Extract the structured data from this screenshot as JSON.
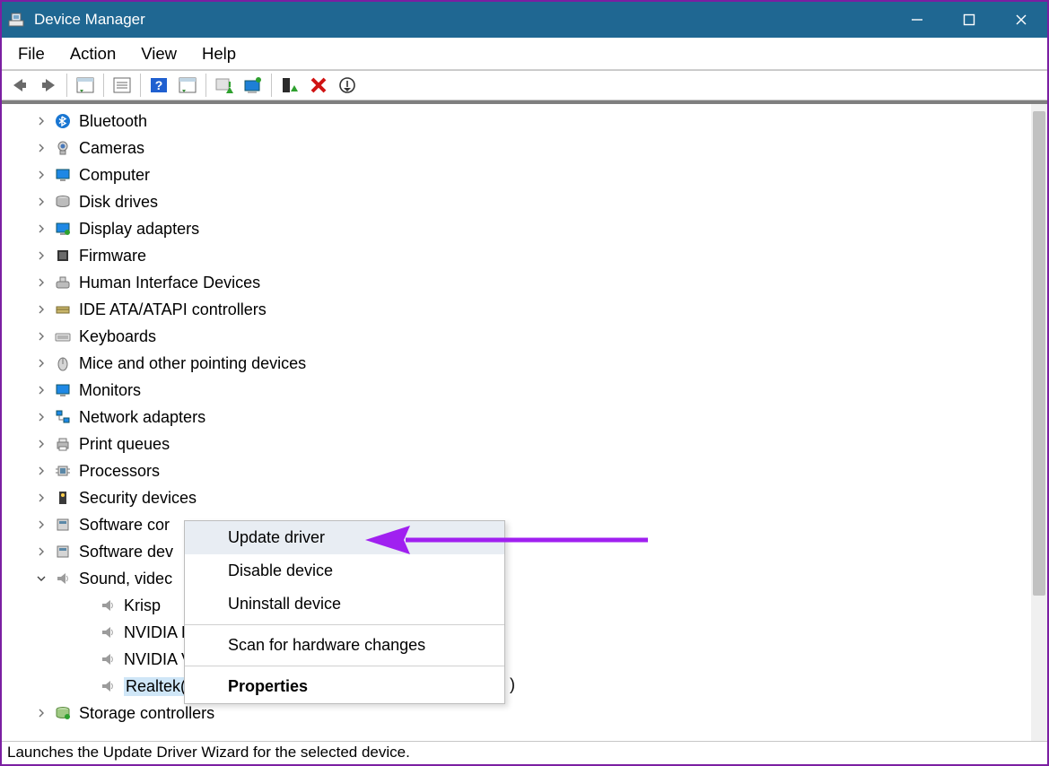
{
  "title": "Device Manager",
  "menubar": [
    "File",
    "Action",
    "View",
    "Help"
  ],
  "toolbar": [
    {
      "name": "back-icon",
      "semantic": "back"
    },
    {
      "name": "forward-icon",
      "semantic": "forward"
    },
    {
      "sep": true
    },
    {
      "name": "show-hidden-icon",
      "semantic": "show-hidden"
    },
    {
      "sep": true
    },
    {
      "name": "properties-icon",
      "semantic": "properties"
    },
    {
      "sep": true
    },
    {
      "name": "help-icon",
      "semantic": "help"
    },
    {
      "name": "show-hidden2-icon",
      "semantic": "show-hidden"
    },
    {
      "sep": true
    },
    {
      "name": "update-driver-icon",
      "semantic": "update-driver"
    },
    {
      "name": "scan-hardware-icon",
      "semantic": "scan-hardware"
    },
    {
      "sep": true
    },
    {
      "name": "enable-device-icon",
      "semantic": "enable-device"
    },
    {
      "name": "uninstall-icon",
      "semantic": "uninstall"
    },
    {
      "name": "disable-device-icon",
      "semantic": "disable-device"
    }
  ],
  "tree": [
    {
      "icon": "bluetooth",
      "label": "Bluetooth",
      "expand": ">"
    },
    {
      "icon": "camera",
      "label": "Cameras",
      "expand": ">"
    },
    {
      "icon": "monitor",
      "label": "Computer",
      "expand": ">"
    },
    {
      "icon": "disk",
      "label": "Disk drives",
      "expand": ">"
    },
    {
      "icon": "display",
      "label": "Display adapters",
      "expand": ">"
    },
    {
      "icon": "firmware",
      "label": "Firmware",
      "expand": ">"
    },
    {
      "icon": "hid",
      "label": "Human Interface Devices",
      "expand": ">"
    },
    {
      "icon": "ide",
      "label": "IDE ATA/ATAPI controllers",
      "expand": ">"
    },
    {
      "icon": "keyboard",
      "label": "Keyboards",
      "expand": ">"
    },
    {
      "icon": "mouse",
      "label": "Mice and other pointing devices",
      "expand": ">"
    },
    {
      "icon": "monitor",
      "label": "Monitors",
      "expand": ">"
    },
    {
      "icon": "network",
      "label": "Network adapters",
      "expand": ">"
    },
    {
      "icon": "printer",
      "label": "Print queues",
      "expand": ">"
    },
    {
      "icon": "processor",
      "label": "Processors",
      "expand": ">"
    },
    {
      "icon": "security",
      "label": "Security devices",
      "expand": ">"
    },
    {
      "icon": "software",
      "label": "Software cor",
      "expand": ">",
      "truncated": true
    },
    {
      "icon": "software",
      "label": "Software dev",
      "expand": ">",
      "truncated": true
    },
    {
      "icon": "sound",
      "label": "Sound, videc",
      "expand": "v",
      "truncated": true,
      "children": [
        {
          "icon": "sound",
          "label": "Krisp"
        },
        {
          "icon": "sound",
          "label": "NVIDIA H"
        },
        {
          "icon": "sound",
          "label": "NVIDIA V"
        },
        {
          "icon": "sound",
          "label": "Realtek(R) Audio",
          "selected": true
        }
      ]
    },
    {
      "icon": "storage",
      "label": "Storage controllers",
      "expand": ">"
    }
  ],
  "context_menu": {
    "items": [
      {
        "label": "Update driver",
        "highlight": true
      },
      {
        "label": "Disable device"
      },
      {
        "label": "Uninstall device"
      },
      {
        "sep": true
      },
      {
        "label": "Scan for hardware changes"
      },
      {
        "sep": true
      },
      {
        "label": "Properties",
        "bold": true
      }
    ]
  },
  "statusbar": "Launches the Update Driver Wizard for the selected device."
}
